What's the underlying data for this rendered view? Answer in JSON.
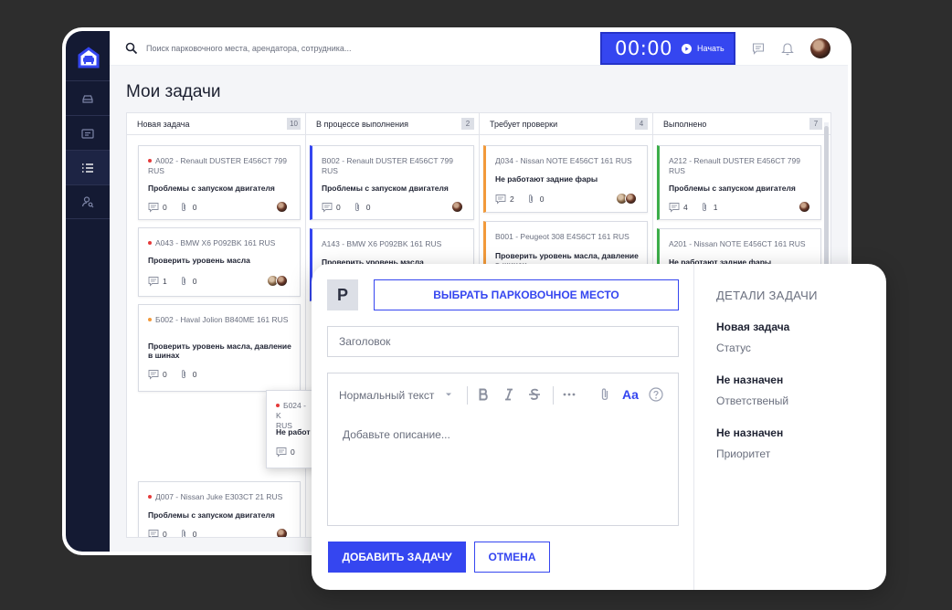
{
  "topbar": {
    "search_placeholder": "Поиск парковочного места, арендатора, сотрудника...",
    "timer": "00:00",
    "timer_button": "Начать"
  },
  "page": {
    "title": "Мои задачи"
  },
  "columns": [
    {
      "title": "Новая задача",
      "count": "10",
      "cards": [
        {
          "code": "А002 - Renault DUSTER E456CT 799 RUS",
          "title": "Проблемы с запуском двигателя",
          "comments": "0",
          "files": "0"
        },
        {
          "code": "А043 - BMW X6 P092BK 161 RUS",
          "title": "Проверить уровень масла",
          "comments": "1",
          "files": "0"
        },
        {
          "code": "Б002 - Haval Jolion  B840ME 161 RUS",
          "title": "Проверить уровень масла, давление в шинах",
          "comments": "0",
          "files": "0"
        },
        {
          "code": "Д007 - Nissan Juke  E303CT 21 RUS",
          "title": "Проблемы с запуском двигателя",
          "comments": "0",
          "files": "0"
        }
      ]
    },
    {
      "title": "В процессе выполнения",
      "count": "2",
      "cards": [
        {
          "code": "В002 - Renault DUSTER E456CT 799 RUS",
          "title": "Проблемы с запуском двигателя",
          "comments": "0",
          "files": "0"
        },
        {
          "code": "А143 - BMW X6 P092BK 161 RUS",
          "title": "Проверить уровень масла",
          "comments": "",
          "files": ""
        }
      ]
    },
    {
      "title": "Требует проверки",
      "count": "4",
      "cards": [
        {
          "code": "Д034 - Nissan NOTE E456CT 161 RUS",
          "title": "Не работают задние фары",
          "comments": "2",
          "files": "0"
        },
        {
          "code": "В001 - Peugeot 308 E4S6CT 161 RUS",
          "title": "Проверить уровень масла, давление в шинах",
          "comments": "",
          "files": ""
        }
      ]
    },
    {
      "title": "Выполнено",
      "count": "7",
      "cards": [
        {
          "code": "А212 - Renault DUSTER E456CT 799 RUS",
          "title": "Проблемы с запуском двигателя",
          "comments": "4",
          "files": "1"
        },
        {
          "code": "А201 - Nissan NOTE E456CT 161 RUS",
          "title": "Не работают задние фары",
          "comments": "",
          "files": ""
        }
      ]
    }
  ],
  "dragging_card": {
    "code": "Б024 - K",
    "code2": "RUS",
    "title": "Не работ",
    "comments": "0"
  },
  "modal": {
    "badge": "P",
    "choose_parking": "ВЫБРАТЬ ПАРКОВОЧНОЕ МЕСТО",
    "title_placeholder": "Заголовок",
    "format_label": "Нормальный текст",
    "aa_label": "Aa",
    "description_placeholder": "Добавьте описание...",
    "add_button": "ДОБАВИТЬ ЗАДАЧУ",
    "cancel_button": "ОТМЕНА",
    "details": {
      "heading": "ДЕТАЛИ ЗАДАЧИ",
      "status_value": "Новая задача",
      "status_label": "Статус",
      "assignee_value": "Не назначен",
      "assignee_label": "Ответственый",
      "priority_value": "Не назначен",
      "priority_label": "Приоритет"
    }
  },
  "colors": {
    "accent": "#3546f0",
    "sidebar": "#141a33",
    "in_progress": "#3546f0",
    "review": "#f29a3a",
    "done": "#3cae4a",
    "urgent": "#e53a3a"
  }
}
